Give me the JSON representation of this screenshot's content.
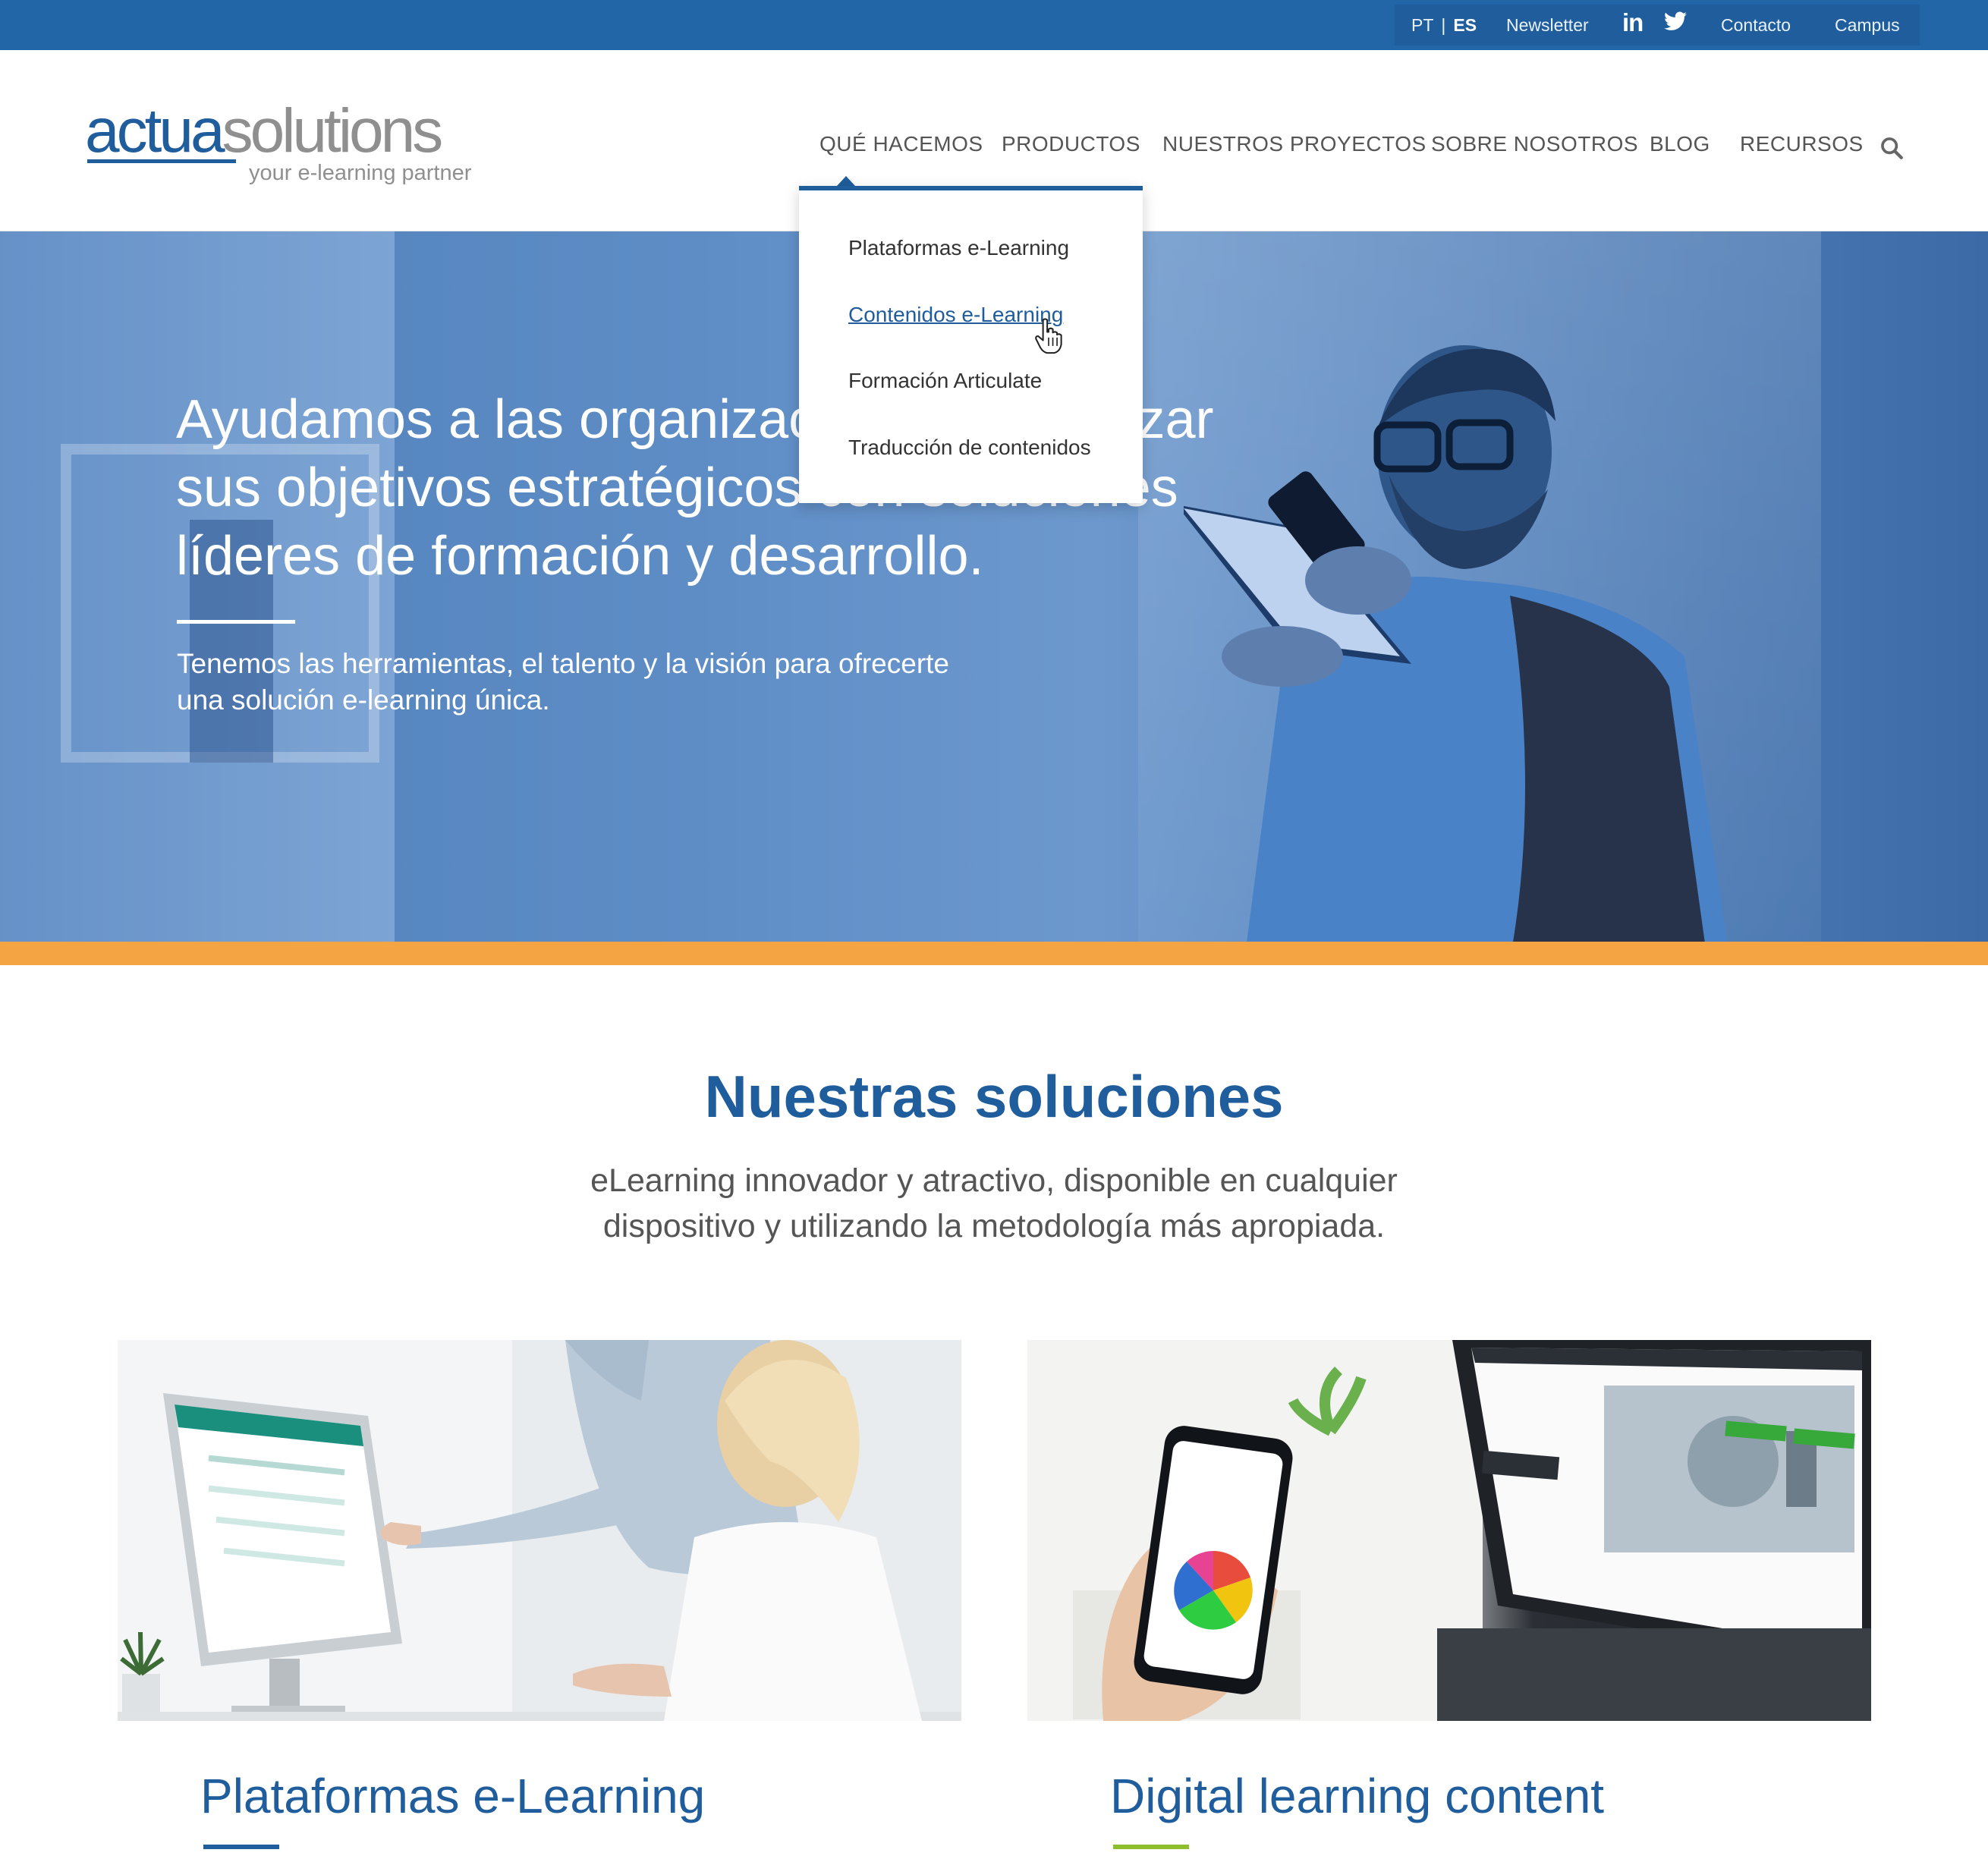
{
  "topbar": {
    "lang_pt": "PT",
    "lang_sep": "|",
    "lang_es": "ES",
    "newsletter": "Newsletter",
    "linkedin_icon": "linkedin-icon",
    "twitter_icon": "twitter-icon",
    "contact": "Contacto",
    "campus": "Campus"
  },
  "logo": {
    "word_a": "actua",
    "word_b": "solutions",
    "tagline": "your e-learning partner"
  },
  "nav": {
    "items": [
      "QUÉ HACEMOS",
      "PRODUCTOS",
      "NUESTROS PROYECTOS",
      "SOBRE NOSOTROS",
      "BLOG",
      "RECURSOS"
    ],
    "search_icon": "search-icon"
  },
  "dropdown": {
    "items": [
      "Plataformas e-Learning",
      "Contenidos e-Learning",
      "Formación Articulate",
      "Traducción de contenidos"
    ]
  },
  "hero": {
    "title_lines": [
      "Ayudamos a las organizaciones a alcanzar",
      "sus objetivos estratégicos con soluciones",
      "líderes de formación y desarrollo."
    ],
    "subtitle_lines": [
      "Tenemos las herramientas, el talento y la visión para ofrecerte",
      "una solución e-learning única."
    ]
  },
  "solutions": {
    "title": "Nuestras soluciones",
    "lead_lines": [
      "eLearning innovador y atractivo, disponible en cualquier",
      "dispositivo y utilizando la metodología más apropiada."
    ],
    "cards": [
      {
        "title": "Plataformas e-Learning",
        "accent": "#1f5d9c"
      },
      {
        "title": "Digital learning content",
        "accent": "#8cbf2b"
      }
    ]
  },
  "colors": {
    "brand_blue": "#1f5d9c",
    "topbar_blue": "#2266a8",
    "orange": "#f5a443",
    "green": "#8cbf2b"
  }
}
